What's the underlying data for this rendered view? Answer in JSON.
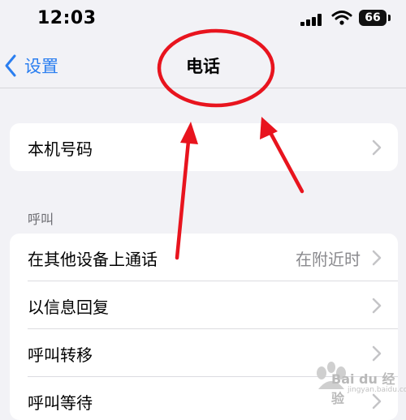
{
  "status_bar": {
    "time": "12:03",
    "battery": "66",
    "icons": [
      "signal-icon",
      "wifi-icon",
      "battery-icon"
    ]
  },
  "nav": {
    "back_label": "设置",
    "title": "电话"
  },
  "group1": [
    {
      "label": "本机号码",
      "value": ""
    }
  ],
  "section_header": "呼叫",
  "group2": [
    {
      "label": "在其他设备上通话",
      "value": "在附近时"
    },
    {
      "label": "以信息回复",
      "value": ""
    },
    {
      "label": "呼叫转移",
      "value": ""
    },
    {
      "label": "呼叫等待",
      "value": ""
    }
  ],
  "watermark": {
    "text": "Bai du 经验",
    "sub": "jingyan.baidu.com"
  },
  "colors": {
    "accent": "#2a7ef0",
    "annotation": "#e8141e",
    "background": "#f2f2f6"
  }
}
